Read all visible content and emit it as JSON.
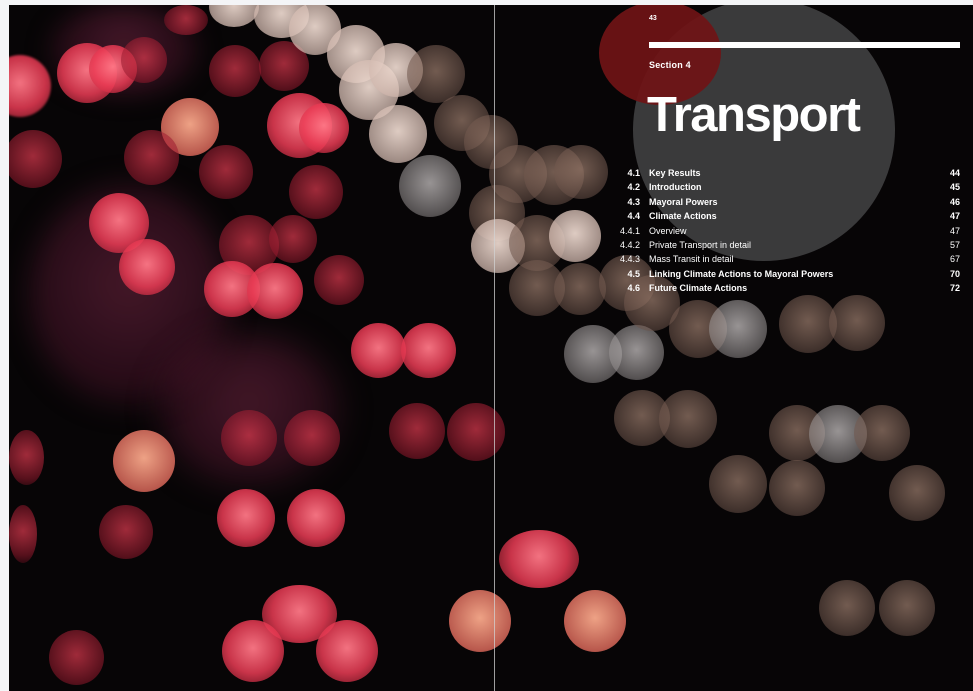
{
  "page": {
    "page_number": "43",
    "section_label": "Section 4",
    "title": "Transport"
  },
  "toc": [
    {
      "num": "4.1",
      "title": "Key Results",
      "page": "44",
      "level": "main"
    },
    {
      "num": "4.2",
      "title": "Introduction",
      "page": "45",
      "level": "main"
    },
    {
      "num": "4.3",
      "title": "Mayoral Powers",
      "page": "46",
      "level": "main"
    },
    {
      "num": "4.4",
      "title": "Climate Actions",
      "page": "47",
      "level": "main"
    },
    {
      "num": "4.4.1",
      "title": "Overview",
      "page": "47",
      "level": "sub"
    },
    {
      "num": "4.4.2",
      "title": "Private Transport in detail",
      "page": "57",
      "level": "sub"
    },
    {
      "num": "4.4.3",
      "title": "Mass Transit in detail",
      "page": "67",
      "level": "sub"
    },
    {
      "num": "4.5",
      "title": "Linking Climate Actions to Mayoral Powers",
      "page": "70",
      "level": "main"
    },
    {
      "num": "4.6",
      "title": "Future Climate Actions",
      "page": "72",
      "level": "main"
    }
  ],
  "colors": {
    "background": "#070506",
    "panel_circle": "#3e3e40",
    "accent_circle": "#701416",
    "text": "#ffffff"
  }
}
